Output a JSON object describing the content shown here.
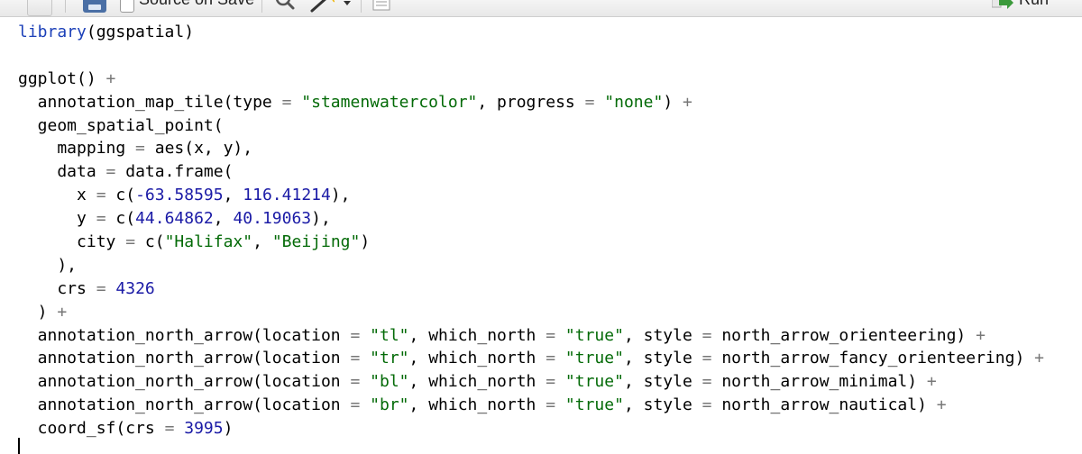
{
  "toolbar": {
    "source_on_save_label": "Source on Save",
    "run_label": "Run",
    "icons": [
      "doc-icon",
      "save-icon",
      "search-icon",
      "magic-wand-icon",
      "chevron-down-icon",
      "list-icon",
      "run-arrow-icon"
    ]
  },
  "colors": {
    "keyword": "#1b3fb8",
    "string": "#036a07",
    "number": "#1a1aa6",
    "operator": "#777777"
  },
  "code": {
    "lines": [
      [
        {
          "t": "kw",
          "v": "library"
        },
        {
          "t": "p",
          "v": "(ggspatial)"
        }
      ],
      [],
      [
        {
          "t": "p",
          "v": "ggplot() "
        },
        {
          "t": "op",
          "v": "+"
        }
      ],
      [
        {
          "t": "p",
          "v": "  annotation_map_tile(type "
        },
        {
          "t": "op",
          "v": "="
        },
        {
          "t": "p",
          "v": " "
        },
        {
          "t": "str",
          "v": "\"stamenwatercolor\""
        },
        {
          "t": "p",
          "v": ", progress "
        },
        {
          "t": "op",
          "v": "="
        },
        {
          "t": "p",
          "v": " "
        },
        {
          "t": "str",
          "v": "\"none\""
        },
        {
          "t": "p",
          "v": ") "
        },
        {
          "t": "op",
          "v": "+"
        }
      ],
      [
        {
          "t": "p",
          "v": "  geom_spatial_point("
        }
      ],
      [
        {
          "t": "p",
          "v": "    mapping "
        },
        {
          "t": "op",
          "v": "="
        },
        {
          "t": "p",
          "v": " aes(x, y),"
        }
      ],
      [
        {
          "t": "p",
          "v": "    data "
        },
        {
          "t": "op",
          "v": "="
        },
        {
          "t": "p",
          "v": " data.frame("
        }
      ],
      [
        {
          "t": "p",
          "v": "      x "
        },
        {
          "t": "op",
          "v": "="
        },
        {
          "t": "p",
          "v": " c("
        },
        {
          "t": "num",
          "v": "-63.58595"
        },
        {
          "t": "p",
          "v": ", "
        },
        {
          "t": "num",
          "v": "116.41214"
        },
        {
          "t": "p",
          "v": "),"
        }
      ],
      [
        {
          "t": "p",
          "v": "      y "
        },
        {
          "t": "op",
          "v": "="
        },
        {
          "t": "p",
          "v": " c("
        },
        {
          "t": "num",
          "v": "44.64862"
        },
        {
          "t": "p",
          "v": ", "
        },
        {
          "t": "num",
          "v": "40.19063"
        },
        {
          "t": "p",
          "v": "),"
        }
      ],
      [
        {
          "t": "p",
          "v": "      city "
        },
        {
          "t": "op",
          "v": "="
        },
        {
          "t": "p",
          "v": " c("
        },
        {
          "t": "str",
          "v": "\"Halifax\""
        },
        {
          "t": "p",
          "v": ", "
        },
        {
          "t": "str",
          "v": "\"Beijing\""
        },
        {
          "t": "p",
          "v": ")"
        }
      ],
      [
        {
          "t": "p",
          "v": "    ),"
        }
      ],
      [
        {
          "t": "p",
          "v": "    crs "
        },
        {
          "t": "op",
          "v": "="
        },
        {
          "t": "p",
          "v": " "
        },
        {
          "t": "num",
          "v": "4326"
        }
      ],
      [
        {
          "t": "p",
          "v": "  ) "
        },
        {
          "t": "op",
          "v": "+"
        }
      ],
      [
        {
          "t": "p",
          "v": "  annotation_north_arrow(location "
        },
        {
          "t": "op",
          "v": "="
        },
        {
          "t": "p",
          "v": " "
        },
        {
          "t": "str",
          "v": "\"tl\""
        },
        {
          "t": "p",
          "v": ", which_north "
        },
        {
          "t": "op",
          "v": "="
        },
        {
          "t": "p",
          "v": " "
        },
        {
          "t": "str",
          "v": "\"true\""
        },
        {
          "t": "p",
          "v": ", style "
        },
        {
          "t": "op",
          "v": "="
        },
        {
          "t": "p",
          "v": " north_arrow_orienteering) "
        },
        {
          "t": "op",
          "v": "+"
        }
      ],
      [
        {
          "t": "p",
          "v": "  annotation_north_arrow(location "
        },
        {
          "t": "op",
          "v": "="
        },
        {
          "t": "p",
          "v": " "
        },
        {
          "t": "str",
          "v": "\"tr\""
        },
        {
          "t": "p",
          "v": ", which_north "
        },
        {
          "t": "op",
          "v": "="
        },
        {
          "t": "p",
          "v": " "
        },
        {
          "t": "str",
          "v": "\"true\""
        },
        {
          "t": "p",
          "v": ", style "
        },
        {
          "t": "op",
          "v": "="
        },
        {
          "t": "p",
          "v": " north_arrow_fancy_orienteering) "
        },
        {
          "t": "op",
          "v": "+"
        }
      ],
      [
        {
          "t": "p",
          "v": "  annotation_north_arrow(location "
        },
        {
          "t": "op",
          "v": "="
        },
        {
          "t": "p",
          "v": " "
        },
        {
          "t": "str",
          "v": "\"bl\""
        },
        {
          "t": "p",
          "v": ", which_north "
        },
        {
          "t": "op",
          "v": "="
        },
        {
          "t": "p",
          "v": " "
        },
        {
          "t": "str",
          "v": "\"true\""
        },
        {
          "t": "p",
          "v": ", style "
        },
        {
          "t": "op",
          "v": "="
        },
        {
          "t": "p",
          "v": " north_arrow_minimal) "
        },
        {
          "t": "op",
          "v": "+"
        }
      ],
      [
        {
          "t": "p",
          "v": "  annotation_north_arrow(location "
        },
        {
          "t": "op",
          "v": "="
        },
        {
          "t": "p",
          "v": " "
        },
        {
          "t": "str",
          "v": "\"br\""
        },
        {
          "t": "p",
          "v": ", which_north "
        },
        {
          "t": "op",
          "v": "="
        },
        {
          "t": "p",
          "v": " "
        },
        {
          "t": "str",
          "v": "\"true\""
        },
        {
          "t": "p",
          "v": ", style "
        },
        {
          "t": "op",
          "v": "="
        },
        {
          "t": "p",
          "v": " north_arrow_nautical) "
        },
        {
          "t": "op",
          "v": "+"
        }
      ],
      [
        {
          "t": "p",
          "v": "  coord_sf(crs "
        },
        {
          "t": "op",
          "v": "="
        },
        {
          "t": "p",
          "v": " "
        },
        {
          "t": "num",
          "v": "3995"
        },
        {
          "t": "p",
          "v": ")"
        }
      ]
    ]
  }
}
